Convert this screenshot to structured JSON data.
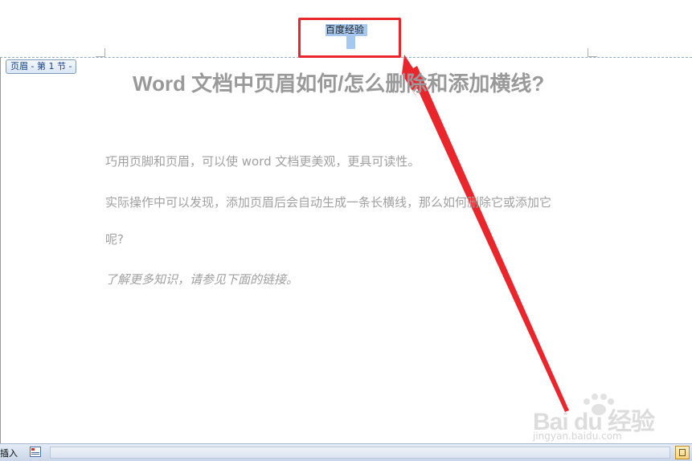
{
  "header": {
    "section_tag": "页眉 - 第 1 节 -",
    "text": "百度经验"
  },
  "document": {
    "title": "Word 文档中页眉如何/怎么删除和添加横线?",
    "paragraphs": [
      "巧用页脚和页眉，可以使 word 文档更美观，更具可读性。",
      "实际操作中可以发现，添加页眉后会自动生成一条长横线，那么如何删除它或添加它",
      "呢?",
      "了解更多知识，请参见下面的链接。"
    ]
  },
  "watermark": {
    "logo_text": "Bai du 经验",
    "url": "jingyan.baidu.com"
  },
  "statusbar": {
    "mode_label": "插入",
    "doc_icon": "document-icon",
    "view_icon": "print-layout-icon"
  },
  "colors": {
    "annotation_red": "#e8262c",
    "selection_blue": "#a6c8ee",
    "header_divider": "#8faac7"
  }
}
